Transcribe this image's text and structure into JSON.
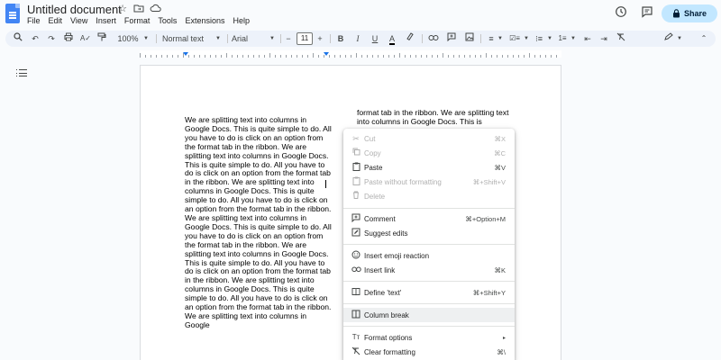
{
  "document": {
    "title": "Untitled document",
    "menus": [
      "File",
      "Edit",
      "View",
      "Insert",
      "Format",
      "Tools",
      "Extensions",
      "Help"
    ],
    "share_label": "Share"
  },
  "icons": {
    "logo": "docs-logo-icon",
    "star": "☆",
    "move": "folder-icon",
    "cloud": "cloud-icon",
    "history": "history-icon",
    "comments": "comment-icon",
    "lock": "lock-icon"
  },
  "toolbar": {
    "zoom": "100%",
    "style": "Normal text",
    "font": "Arial",
    "font_size": "11"
  },
  "body": {
    "col1_text": "We are splitting text into columns in Google Docs. This is quite simple to do. All you have to do is click on an option from the format tab in the ribbon. We are splitting text into columns in Google Docs. This is quite simple to do. All you have to do is click on an option from the format tab in the ribbon. We are splitting text into columns in Google Docs. This is quite simple to do. All you have to do is click on an option from the format tab in the ribbon. We are splitting text into columns in Google Docs. This is quite simple to do. All you have to do is click on an option from the format tab in the ribbon. We are splitting text into columns in Google Docs. This is quite simple to do. All you have to do is click on an option from the format tab in the ribbon. We are splitting text into columns in Google Docs. This is quite simple to do. All you have to do is click on an option from the format tab in the ribbon. We are splitting text into columns in Google",
    "col2_text": "format tab in the ribbon. We are splitting text into columns in Google Docs. This is"
  },
  "context_menu": {
    "items": [
      {
        "label": "Cut",
        "shortcut": "⌘X",
        "icon": "cut-icon",
        "disabled": true
      },
      {
        "label": "Copy",
        "shortcut": "⌘C",
        "icon": "copy-icon",
        "disabled": true
      },
      {
        "label": "Paste",
        "shortcut": "⌘V",
        "icon": "paste-icon",
        "disabled": false
      },
      {
        "label": "Paste without formatting",
        "shortcut": "⌘+Shift+V",
        "icon": "paste-plain-icon",
        "disabled": true
      },
      {
        "label": "Delete",
        "shortcut": "",
        "icon": "trash-icon",
        "disabled": true
      },
      {
        "label": "Comment",
        "shortcut": "⌘+Option+M",
        "icon": "add-comment-icon",
        "disabled": false
      },
      {
        "label": "Suggest edits",
        "shortcut": "",
        "icon": "suggest-edit-icon",
        "disabled": false
      },
      {
        "label": "Insert emoji reaction",
        "shortcut": "",
        "icon": "emoji-icon",
        "disabled": false
      },
      {
        "label": "Insert link",
        "shortcut": "⌘K",
        "icon": "link-icon",
        "disabled": false
      },
      {
        "label": "Define 'text'",
        "shortcut": "⌘+Shift+Y",
        "icon": "define-icon",
        "disabled": false
      },
      {
        "label": "Column break",
        "shortcut": "",
        "icon": "column-break-icon",
        "disabled": false,
        "highlighted": true
      },
      {
        "label": "Format options",
        "shortcut": "▸",
        "icon": "format-options-icon",
        "disabled": false
      },
      {
        "label": "Clear formatting",
        "shortcut": "⌘\\",
        "icon": "clear-format-icon",
        "disabled": false
      }
    ]
  }
}
